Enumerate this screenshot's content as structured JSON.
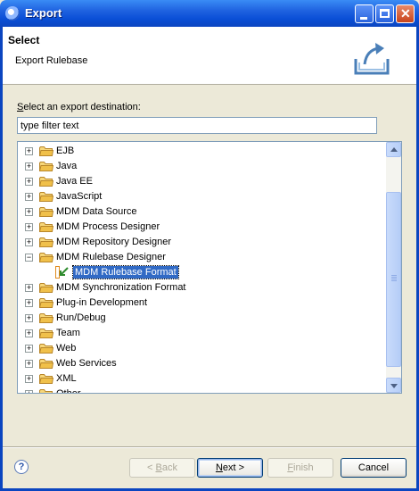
{
  "window": {
    "title": "Export"
  },
  "banner": {
    "heading": "Select",
    "description": "Export Rulebase",
    "icon": "export-wizard-icon"
  },
  "prompt": {
    "mnemonic": "S",
    "rest": "elect an export destination:"
  },
  "filter": {
    "value": "type filter text"
  },
  "tree": {
    "items": [
      {
        "label": "EJB",
        "state": "collapsed"
      },
      {
        "label": "Java",
        "state": "collapsed"
      },
      {
        "label": "Java EE",
        "state": "collapsed"
      },
      {
        "label": "JavaScript",
        "state": "collapsed"
      },
      {
        "label": "MDM Data Source",
        "state": "collapsed"
      },
      {
        "label": "MDM Process Designer",
        "state": "collapsed"
      },
      {
        "label": "MDM Repository Designer",
        "state": "collapsed"
      },
      {
        "label": "MDM Rulebase Designer",
        "state": "expanded"
      },
      {
        "label": "MDM Rulebase Format",
        "state": "leaf",
        "selected": true
      },
      {
        "label": "MDM Synchronization Format",
        "state": "collapsed"
      },
      {
        "label": "Plug-in Development",
        "state": "collapsed"
      },
      {
        "label": "Run/Debug",
        "state": "collapsed"
      },
      {
        "label": "Team",
        "state": "collapsed"
      },
      {
        "label": "Web",
        "state": "collapsed"
      },
      {
        "label": "Web Services",
        "state": "collapsed"
      },
      {
        "label": "XML",
        "state": "collapsed"
      },
      {
        "label": "Other",
        "state": "collapsed"
      }
    ],
    "expander_collapsed": "+",
    "expander_expanded": "−"
  },
  "buttons": {
    "back": {
      "mnemonic": "B",
      "pre": "< ",
      "post": "ack",
      "enabled": false
    },
    "next": {
      "mnemonic": "N",
      "pre": "",
      "post": "ext >",
      "enabled": true
    },
    "finish": {
      "mnemonic": "F",
      "pre": "",
      "post": "inish",
      "enabled": false
    },
    "cancel": {
      "label": "Cancel",
      "enabled": true
    }
  },
  "help": {
    "glyph": "?"
  },
  "colors": {
    "selection": "#316ac5",
    "titlebar": "#0a4fd6",
    "folder": "#f0c04a"
  }
}
